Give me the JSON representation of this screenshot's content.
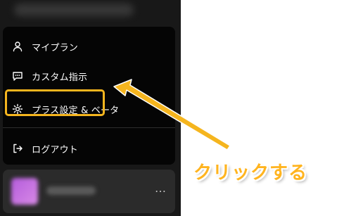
{
  "menu": {
    "items": [
      {
        "label": "マイプラン",
        "icon": "person-icon"
      },
      {
        "label": "カスタム指示",
        "icon": "chat-bubble-icon"
      },
      {
        "label": "プラス設定 & ベータ",
        "icon": "gear-icon"
      },
      {
        "label": "ログアウト",
        "icon": "logout-icon"
      }
    ]
  },
  "user_card": {
    "more_label": "…"
  },
  "annotation": {
    "text": "クリックする",
    "color": "#f5b51e"
  }
}
